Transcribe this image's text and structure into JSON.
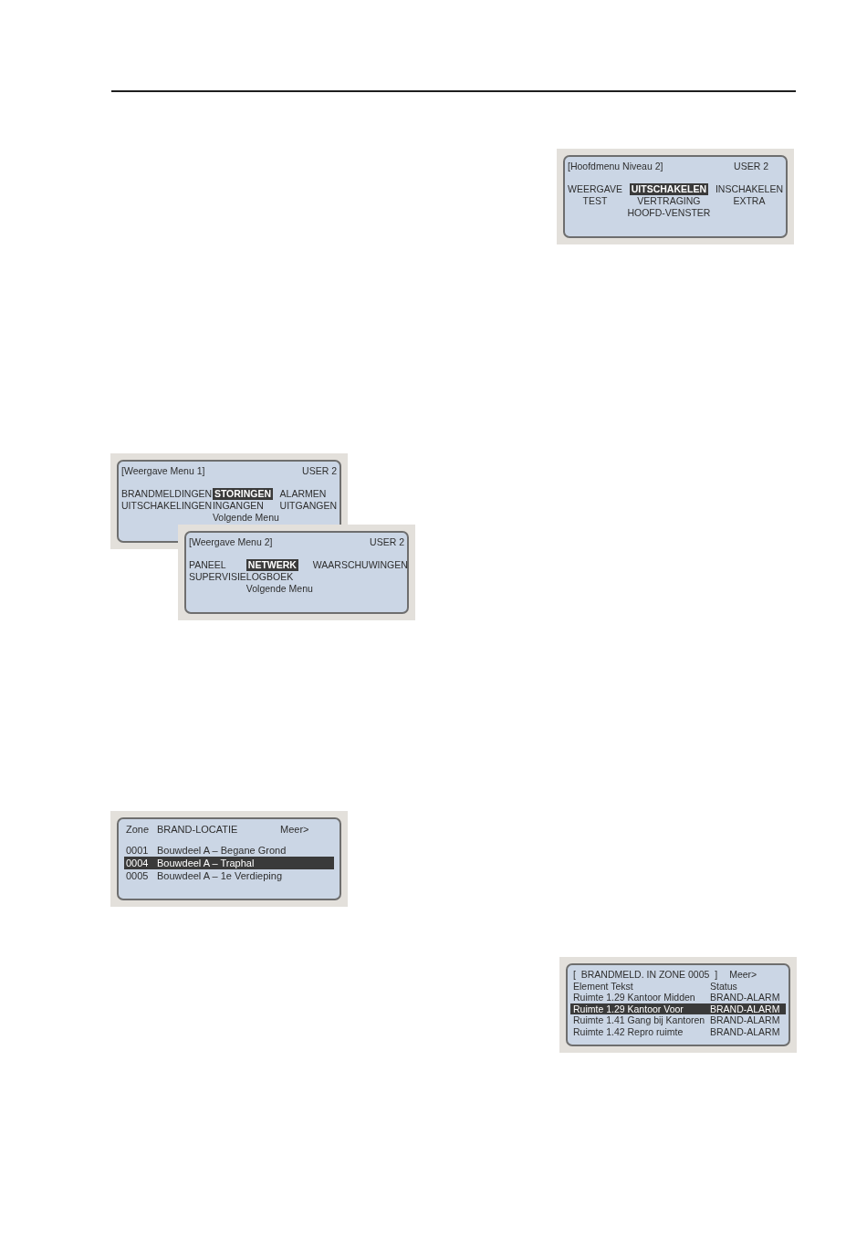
{
  "screens": [
    {
      "kind": "main_menu",
      "title": "[Hoofdmenu Niveau 2]",
      "user": "USER 2",
      "rows": [
        [
          {
            "label": "WEERGAVE",
            "selected": false
          },
          {
            "label": "UITSCHAKELEN",
            "selected": true
          },
          {
            "label": "INSCHAKELEN",
            "selected": false
          }
        ],
        [
          {
            "label": "TEST",
            "selected": false
          },
          {
            "label": "VERTRAGING",
            "selected": false
          },
          {
            "label": "EXTRA",
            "selected": false
          }
        ]
      ],
      "footer_item": {
        "label": "HOOFD-VENSTER",
        "selected": false
      }
    },
    {
      "kind": "sub_menu",
      "title": "[Weergave Menu 1]",
      "user": "USER 2",
      "rows": [
        [
          {
            "label": "BRANDMELDINGEN",
            "selected": false
          },
          {
            "label": "STORINGEN",
            "selected": true
          },
          {
            "label": "ALARMEN",
            "selected": false
          }
        ],
        [
          {
            "label": "UITSCHAKELINGEN",
            "selected": false
          },
          {
            "label": "INGANGEN",
            "selected": false
          },
          {
            "label": "UITGANGEN",
            "selected": false
          }
        ]
      ],
      "footer_item": {
        "label": "Volgende Menu",
        "selected": false
      }
    },
    {
      "kind": "sub_menu",
      "title": "[Weergave Menu 2]",
      "user": "USER 2",
      "rows": [
        [
          {
            "label": "PANEEL",
            "selected": false
          },
          {
            "label": "NETWERK",
            "selected": true
          },
          {
            "label": "WAARSCHUWINGEN",
            "selected": false
          }
        ],
        [
          {
            "label": "SUPERVISIE",
            "selected": false
          },
          {
            "label": "LOGBOEK",
            "selected": false
          }
        ]
      ],
      "footer_item": {
        "label": "Volgende Menu",
        "selected": false
      }
    },
    {
      "kind": "zone_list",
      "columns": [
        "Zone",
        "BRAND-LOCATIE"
      ],
      "more": "Meer>",
      "rows": [
        {
          "zone": "0001",
          "location": "Bouwdeel A – Begane Grond",
          "selected": false
        },
        {
          "zone": "0004",
          "location": "Bouwdeel A – Traphal",
          "selected": true
        },
        {
          "zone": "0005",
          "location": "Bouwdeel A – 1e Verdieping",
          "selected": false
        }
      ]
    },
    {
      "kind": "alarm_list",
      "title": "[  BRANDMELD. IN ZONE 0005  ]",
      "more": "Meer>",
      "columns": [
        "Element Tekst",
        "Status"
      ],
      "rows": [
        {
          "text": "Ruimte 1.29 Kantoor Midden",
          "status": "BRAND-ALARM",
          "selected": false
        },
        {
          "text": "Ruimte 1.29 Kantoor Voor",
          "status": "BRAND-ALARM",
          "selected": true
        },
        {
          "text": "Ruimte 1.41 Gang bij Kantoren",
          "status": "BRAND-ALARM",
          "selected": false
        },
        {
          "text": "Ruimte 1.42 Repro ruimte",
          "status": "BRAND-ALARM",
          "selected": false
        }
      ]
    }
  ]
}
